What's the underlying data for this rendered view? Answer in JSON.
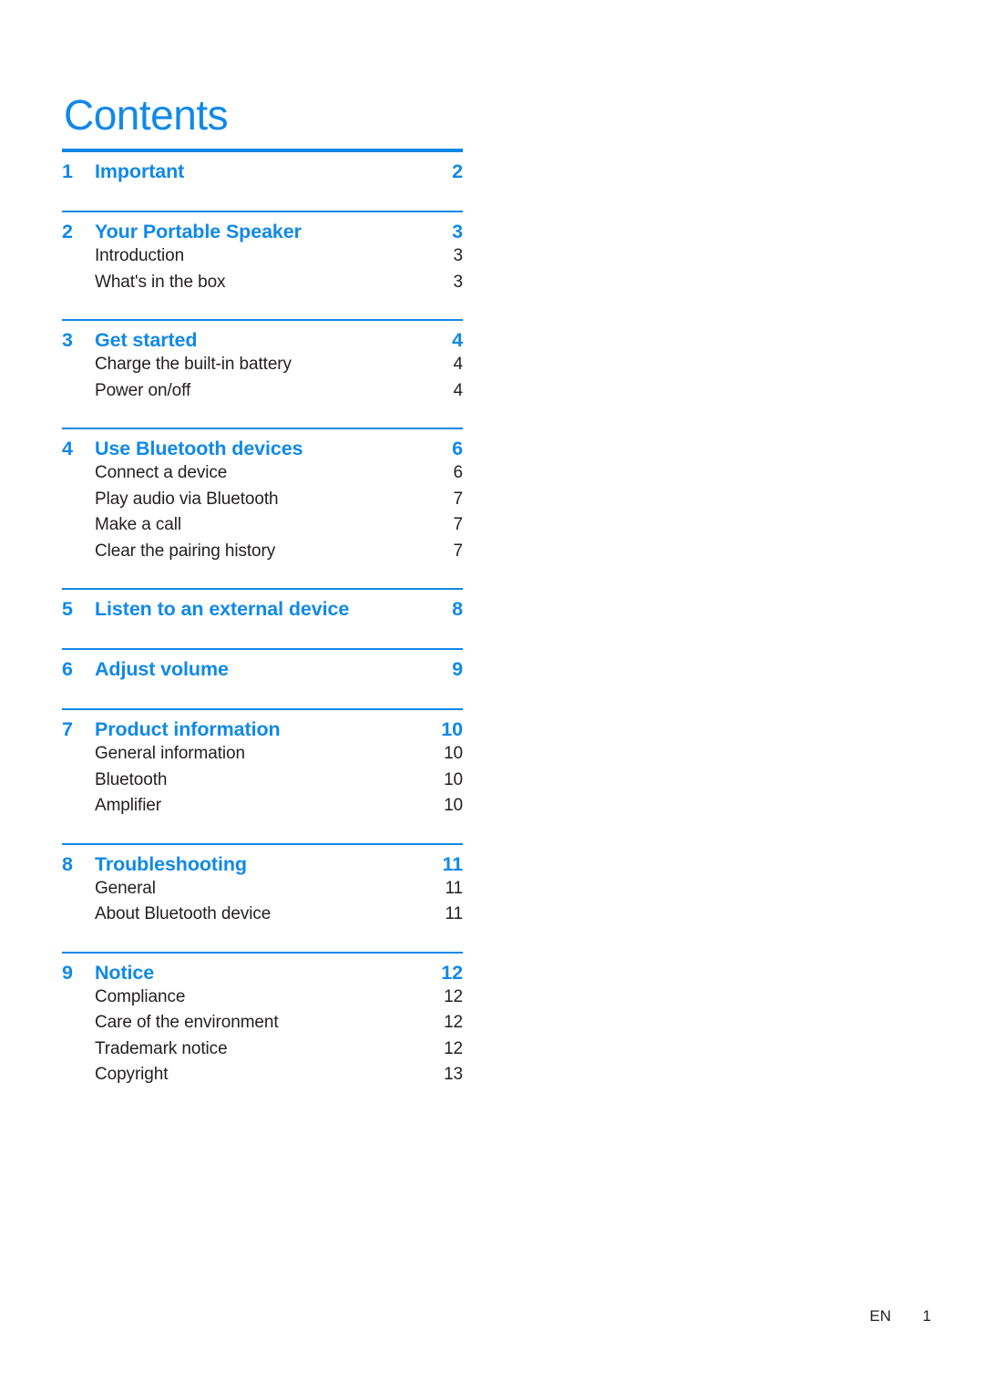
{
  "document": {
    "title": "Contents",
    "accent_color": "#1089e8",
    "body_text_color": "#231f20"
  },
  "toc": {
    "sections": [
      {
        "number": "1",
        "title": "Important",
        "page": "2",
        "items": []
      },
      {
        "number": "2",
        "title": "Your Portable Speaker",
        "page": "3",
        "items": [
          {
            "label": "Introduction",
            "page": "3"
          },
          {
            "label": "What's in the box",
            "page": "3"
          }
        ]
      },
      {
        "number": "3",
        "title": "Get started",
        "page": "4",
        "items": [
          {
            "label": "Charge the built-in battery",
            "page": "4"
          },
          {
            "label": "Power on/off",
            "page": "4"
          }
        ]
      },
      {
        "number": "4",
        "title": "Use Bluetooth devices",
        "page": "6",
        "items": [
          {
            "label": "Connect a device",
            "page": "6"
          },
          {
            "label": "Play audio via Bluetooth",
            "page": "7"
          },
          {
            "label": "Make a call",
            "page": "7"
          },
          {
            "label": "Clear the pairing history",
            "page": "7"
          }
        ]
      },
      {
        "number": "5",
        "title": "Listen to an external device",
        "page": "8",
        "items": []
      },
      {
        "number": "6",
        "title": "Adjust volume",
        "page": "9",
        "items": []
      },
      {
        "number": "7",
        "title": "Product information",
        "page": "10",
        "items": [
          {
            "label": "General information",
            "page": "10"
          },
          {
            "label": "Bluetooth",
            "page": "10"
          },
          {
            "label": "Amplifier",
            "page": "10"
          }
        ]
      },
      {
        "number": "8",
        "title": "Troubleshooting",
        "page": "11",
        "items": [
          {
            "label": "General",
            "page": "11"
          },
          {
            "label": "About Bluetooth device",
            "page": "11"
          }
        ]
      },
      {
        "number": "9",
        "title": "Notice",
        "page": "12",
        "items": [
          {
            "label": "Compliance",
            "page": "12"
          },
          {
            "label": "Care of the environment",
            "page": "12"
          },
          {
            "label": "Trademark notice",
            "page": "12"
          },
          {
            "label": "Copyright",
            "page": "13"
          }
        ]
      }
    ]
  },
  "footer": {
    "language": "EN",
    "page_number": "1"
  }
}
